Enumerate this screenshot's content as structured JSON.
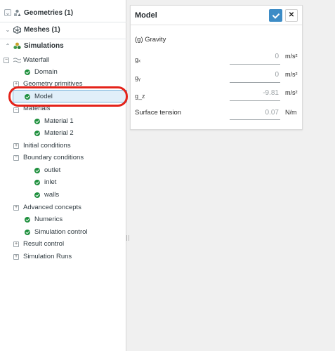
{
  "tree": {
    "geometries": {
      "label": "Geometries (1)",
      "toggle": "⌄"
    },
    "meshes": {
      "label": "Meshes (1)",
      "toggle": "⌄"
    },
    "simulations": {
      "label": "Simulations",
      "toggle": "⌃"
    },
    "waterfall": {
      "label": "Waterfall",
      "toggle": "−"
    },
    "domain": {
      "label": "Domain"
    },
    "geometry_primitives": {
      "label": "Geometry primitives",
      "toggle": "+"
    },
    "model": {
      "label": "Model"
    },
    "materials": {
      "label": "Materials",
      "toggle": "−"
    },
    "material_1": {
      "label": "Material 1"
    },
    "material_2": {
      "label": "Material 2"
    },
    "initial_conditions": {
      "label": "Initial conditions",
      "toggle": "+"
    },
    "boundary_conditions": {
      "label": "Boundary conditions",
      "toggle": "−"
    },
    "outlet": {
      "label": "outlet"
    },
    "inlet": {
      "label": "inlet"
    },
    "walls": {
      "label": "walls"
    },
    "advanced_concepts": {
      "label": "Advanced concepts",
      "toggle": "+"
    },
    "numerics": {
      "label": "Numerics"
    },
    "simulation_control": {
      "label": "Simulation control"
    },
    "result_control": {
      "label": "Result control",
      "toggle": "+"
    },
    "simulation_runs": {
      "label": "Simulation Runs",
      "toggle": "+"
    }
  },
  "panel": {
    "title": "Model",
    "ok_icon": "checkmark-icon",
    "close_label": "✕",
    "section": "(g) Gravity",
    "gx": {
      "label": "gₓ",
      "value": "0",
      "unit": "m/s²"
    },
    "gy": {
      "label": "gᵧ",
      "value": "0",
      "unit": "m/s²"
    },
    "gz": {
      "label": "g_z",
      "value": "-9.81",
      "unit": "m/s²"
    },
    "surface_tension": {
      "label": "Surface tension",
      "value": "0.07",
      "unit": "N/m"
    }
  },
  "colors": {
    "accent": "#3d8cc6",
    "selection": "#e1eff9",
    "check": "#1d8f3c",
    "highlight_ring": "#e4231a"
  }
}
